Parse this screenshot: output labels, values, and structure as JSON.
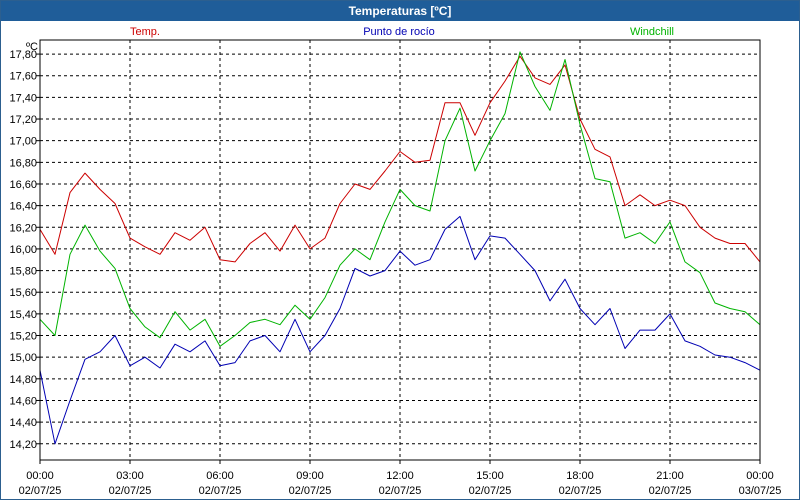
{
  "window": {
    "title": "Temperaturas [ºC]"
  },
  "colors": {
    "temp": "#cc0000",
    "dew": "#0000b3",
    "windchill": "#00b300",
    "grid": "#000000",
    "titlebar": "#1f5d99"
  },
  "chart_data": {
    "type": "line",
    "title": "Temperaturas [ºC]",
    "unit_label": "ºC",
    "grid": true,
    "legend_placement": "top",
    "y_range": [
      14.05,
      17.93
    ],
    "y_ticks": [
      "14,20",
      "14,40",
      "14,60",
      "14,80",
      "15,00",
      "15,20",
      "15,40",
      "15,60",
      "15,80",
      "16,00",
      "16,20",
      "16,40",
      "16,60",
      "16,80",
      "17,00",
      "17,20",
      "17,40",
      "17,60",
      "17,80"
    ],
    "y_tick_values": [
      14.2,
      14.4,
      14.6,
      14.8,
      15.0,
      15.2,
      15.4,
      15.6,
      15.8,
      16.0,
      16.2,
      16.4,
      16.6,
      16.8,
      17.0,
      17.2,
      17.4,
      17.6,
      17.8
    ],
    "x_range_hours": [
      0,
      24
    ],
    "x_ticks": [
      {
        "time": "00:00",
        "date": "02/07/25"
      },
      {
        "time": "03:00",
        "date": "02/07/25"
      },
      {
        "time": "06:00",
        "date": "02/07/25"
      },
      {
        "time": "09:00",
        "date": "02/07/25"
      },
      {
        "time": "12:00",
        "date": "02/07/25"
      },
      {
        "time": "15:00",
        "date": "02/07/25"
      },
      {
        "time": "18:00",
        "date": "02/07/25"
      },
      {
        "time": "21:00",
        "date": "02/07/25"
      },
      {
        "time": "00:00",
        "date": "03/07/25"
      }
    ],
    "x_hours": [
      0,
      0.5,
      1,
      1.5,
      2,
      2.5,
      3,
      3.5,
      4,
      4.5,
      5,
      5.5,
      6,
      6.5,
      7,
      7.5,
      8,
      8.5,
      9,
      9.5,
      10,
      10.5,
      11,
      11.5,
      12,
      12.5,
      13,
      13.5,
      14,
      14.5,
      15,
      15.5,
      16,
      16.5,
      17,
      17.5,
      18,
      18.5,
      19,
      19.5,
      20,
      20.5,
      21,
      21.5,
      22,
      22.5,
      23,
      23.5,
      24
    ],
    "series": [
      {
        "name": "Temp.",
        "color": "#cc0000",
        "values": [
          16.18,
          15.95,
          16.52,
          16.7,
          16.55,
          16.42,
          16.1,
          16.02,
          15.95,
          16.15,
          16.08,
          16.2,
          15.9,
          15.88,
          16.05,
          16.15,
          15.98,
          16.22,
          16.0,
          16.1,
          16.42,
          16.6,
          16.55,
          16.72,
          16.9,
          16.8,
          16.82,
          17.35,
          17.35,
          17.05,
          17.35,
          17.55,
          17.78,
          17.58,
          17.52,
          17.7,
          17.2,
          16.92,
          16.85,
          16.4,
          16.5,
          16.4,
          16.45,
          16.4,
          16.2,
          16.1,
          16.05,
          16.05,
          15.88
        ]
      },
      {
        "name": "Punto de rocío",
        "color": "#0000b3",
        "values": [
          14.88,
          14.2,
          14.6,
          14.98,
          15.05,
          15.2,
          14.92,
          15.0,
          14.9,
          15.12,
          15.05,
          15.15,
          14.92,
          14.95,
          15.15,
          15.2,
          15.05,
          15.35,
          15.05,
          15.2,
          15.45,
          15.82,
          15.75,
          15.8,
          15.98,
          15.85,
          15.9,
          16.18,
          16.3,
          15.9,
          16.12,
          16.1,
          15.95,
          15.8,
          15.52,
          15.72,
          15.45,
          15.3,
          15.45,
          15.08,
          15.25,
          15.25,
          15.4,
          15.15,
          15.1,
          15.02,
          15.0,
          14.95,
          14.88
        ]
      },
      {
        "name": "Windchill",
        "color": "#00b300",
        "values": [
          15.35,
          15.2,
          15.95,
          16.22,
          15.98,
          15.82,
          15.45,
          15.28,
          15.18,
          15.42,
          15.25,
          15.35,
          15.1,
          15.2,
          15.32,
          15.35,
          15.3,
          15.48,
          15.35,
          15.55,
          15.85,
          16.0,
          15.9,
          16.25,
          16.55,
          16.4,
          16.35,
          17.0,
          17.3,
          16.72,
          17.0,
          17.25,
          17.82,
          17.5,
          17.28,
          17.75,
          17.15,
          16.65,
          16.62,
          16.1,
          16.15,
          16.05,
          16.25,
          15.88,
          15.78,
          15.5,
          15.45,
          15.42,
          15.3
        ]
      }
    ]
  }
}
